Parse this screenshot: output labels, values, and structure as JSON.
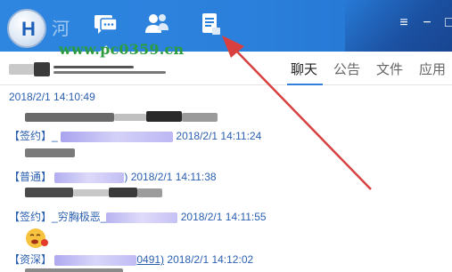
{
  "watermark": "www.pc0359.cn",
  "logo": {
    "glyph": "H",
    "faded_text": "河"
  },
  "nav": [
    {
      "name": "chat",
      "icon": "chat-icon",
      "active": true
    },
    {
      "name": "contacts",
      "icon": "contacts-icon",
      "active": false
    },
    {
      "name": "notes",
      "icon": "document-icon",
      "active": false
    }
  ],
  "window_controls": {
    "menu": "≡",
    "minimize": "−",
    "maximize": "□"
  },
  "header": {
    "tabs": [
      "聊天",
      "公告",
      "文件",
      "应用"
    ],
    "active_tab": "聊天"
  },
  "messages": {
    "time_separator": "2018/2/1 14:10:49",
    "items": [
      {
        "badge": "【签约】",
        "sender_prefix": "_",
        "timestamp": "2018/2/1 14:11:24"
      },
      {
        "badge": "【普通】",
        "sender_prefix": "",
        "timestamp": ") 2018/2/1 14:11:38"
      },
      {
        "badge": "【签约】",
        "sender_prefix": "_穷胸极恶_",
        "timestamp": "2018/2/1 14:11:55"
      },
      {
        "badge": "【资深】",
        "sender_prefix": "",
        "id_tail": "0491)",
        "timestamp": "2018/2/1 14:12:02"
      }
    ]
  },
  "colors": {
    "topbar": "#2b80dc",
    "accent": "#2f7fd8",
    "sender_text": "#2a5fb0",
    "watermark": "#2c9d3e",
    "annotation_arrow": "#d84040"
  }
}
